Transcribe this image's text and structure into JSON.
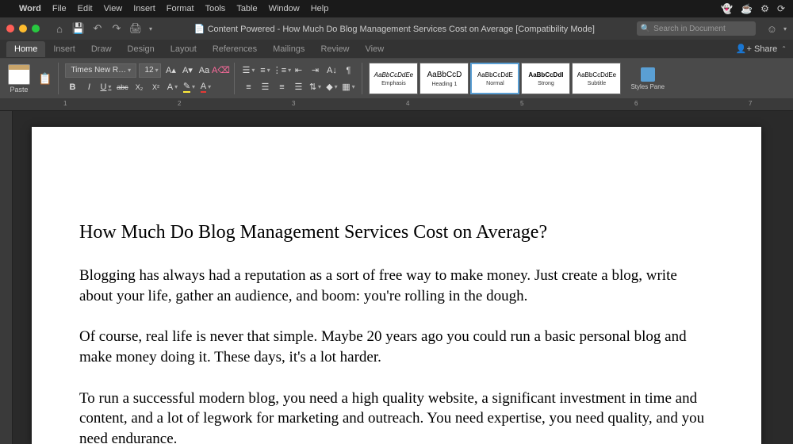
{
  "menubar": {
    "app": "Word",
    "items": [
      "File",
      "Edit",
      "View",
      "Insert",
      "Format",
      "Tools",
      "Table",
      "Window",
      "Help"
    ]
  },
  "titlebar": {
    "doc_title": "Content Powered - How Much Do Blog Management Services Cost on Average [Compatibility Mode]",
    "search_placeholder": "Search in Document"
  },
  "tabs": {
    "items": [
      "Home",
      "Insert",
      "Draw",
      "Design",
      "Layout",
      "References",
      "Mailings",
      "Review",
      "View"
    ],
    "active": 0,
    "share": "Share"
  },
  "ribbon": {
    "paste": "Paste",
    "font_name": "Times New R…",
    "font_size": "12",
    "bold": "B",
    "italic": "I",
    "underline": "U",
    "strike": "abc",
    "sub": "X₂",
    "sup": "X²",
    "styles": [
      {
        "preview": "AaBbCcDdEe",
        "name": "Emphasis",
        "cls": "emp"
      },
      {
        "preview": "AaBbCcD",
        "name": "Heading 1",
        "cls": "h1"
      },
      {
        "preview": "AaBbCcDdE",
        "name": "Normal",
        "cls": "sel"
      },
      {
        "preview": "AaBbCcDdI",
        "name": "Strong",
        "cls": "str"
      },
      {
        "preview": "AaBbCcDdEe",
        "name": "Subtitle",
        "cls": ""
      }
    ],
    "styles_pane": "Styles Pane"
  },
  "ruler": {
    "marks": [
      "1",
      "2",
      "3",
      "4",
      "5",
      "6",
      "7"
    ]
  },
  "document": {
    "title": "How Much Do Blog Management Services Cost on Average?",
    "p1": "Blogging has always had a reputation as a sort of free way to make money.  Just create a blog, write about your life, gather an audience, and boom: you're rolling in the dough.",
    "p2": "Of course, real life is never that simple.  Maybe 20 years ago you could run a basic personal blog and make money doing it.  These days, it's a lot harder.",
    "p3": "To run a successful modern blog, you need a high quality website, a significant investment in time and content, and a lot of legwork for marketing and outreach.  You need expertise, you need quality, and you need endurance."
  }
}
